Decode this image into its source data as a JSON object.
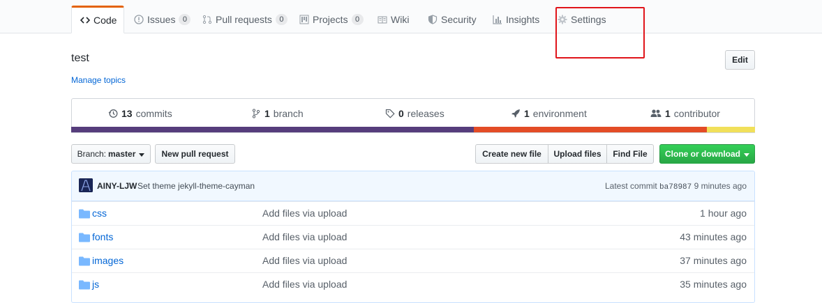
{
  "tabs": [
    {
      "label": "Code",
      "icon": "code-icon",
      "selected": true
    },
    {
      "label": "Issues",
      "count": "0",
      "icon": "issue-icon"
    },
    {
      "label": "Pull requests",
      "count": "0",
      "icon": "pull-request-icon"
    },
    {
      "label": "Projects",
      "count": "0",
      "icon": "project-icon"
    },
    {
      "label": "Wiki",
      "icon": "book-icon"
    },
    {
      "label": "Security",
      "icon": "shield-icon"
    },
    {
      "label": "Insights",
      "icon": "graph-icon"
    },
    {
      "label": "Settings",
      "icon": "gear-icon"
    }
  ],
  "repo": {
    "description": "test",
    "manage_topics": "Manage topics",
    "edit_label": "Edit"
  },
  "summary": {
    "commits_count": "13",
    "commits_label": "commits",
    "branch_count": "1",
    "branch_label": "branch",
    "releases_count": "0",
    "releases_label": "releases",
    "environment_count": "1",
    "environment_label": "environment",
    "contributor_count": "1",
    "contributor_label": "contributor"
  },
  "language_colors": [
    "#563d7c",
    "#e34c26",
    "#f1e05a"
  ],
  "toolbar": {
    "branch_prefix": "Branch:",
    "branch_name": "master",
    "new_pull_request": "New pull request",
    "create_new_file": "Create new file",
    "upload_files": "Upload files",
    "find_file": "Find File",
    "clone_or_download": "Clone or download"
  },
  "latest_commit": {
    "author": "AINY-LJW",
    "message": "Set theme jekyll-theme-cayman",
    "label": "Latest commit",
    "sha": "ba78987",
    "age": "9 minutes ago"
  },
  "files": [
    {
      "name": "css",
      "message": "Add files via upload",
      "age": "1 hour ago"
    },
    {
      "name": "fonts",
      "message": "Add files via upload",
      "age": "43 minutes ago"
    },
    {
      "name": "images",
      "message": "Add files via upload",
      "age": "37 minutes ago"
    },
    {
      "name": "js",
      "message": "Add files via upload",
      "age": "35 minutes ago"
    }
  ]
}
